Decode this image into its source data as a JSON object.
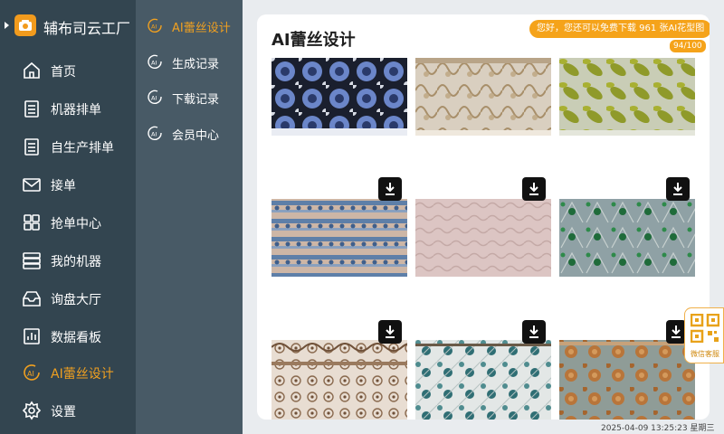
{
  "brand": {
    "name": "辅布司云工厂",
    "accent": "#f29b1d"
  },
  "sidebar": {
    "items": [
      {
        "label": "首页",
        "icon": "home-icon"
      },
      {
        "label": "机器排单",
        "icon": "list-icon"
      },
      {
        "label": "自生产排单",
        "icon": "list-icon"
      },
      {
        "label": "接单",
        "icon": "mail-icon"
      },
      {
        "label": "抢单中心",
        "icon": "grid-icon"
      },
      {
        "label": "我的机器",
        "icon": "server-icon"
      },
      {
        "label": "询盘大厅",
        "icon": "inbox-icon"
      },
      {
        "label": "数据看板",
        "icon": "chart-icon"
      },
      {
        "label": "AI蕾丝设计",
        "icon": "ai-icon",
        "active": true
      },
      {
        "label": "设置",
        "icon": "gear-icon"
      }
    ]
  },
  "submenu": {
    "items": [
      {
        "label": "AI蕾丝设计",
        "icon": "ai-icon",
        "active": true
      },
      {
        "label": "生成记录",
        "icon": "ai-icon"
      },
      {
        "label": "下载记录",
        "icon": "ai-icon"
      },
      {
        "label": "会员中心",
        "icon": "ai-icon"
      }
    ]
  },
  "main": {
    "title": "AI蕾丝设计",
    "notice": "您好，您还可以免费下载 961 张AI花型图",
    "counter": "94/100",
    "images": [
      {
        "name": "blue-floral-lace",
        "has_download": false
      },
      {
        "name": "beige-swirl-lace",
        "has_download": false
      },
      {
        "name": "olive-leaf-lace",
        "has_download": false
      },
      {
        "name": "blue-stripe-lace",
        "has_download": true
      },
      {
        "name": "pink-wave-lace",
        "has_download": true
      },
      {
        "name": "green-floral-lace",
        "has_download": true
      },
      {
        "name": "brown-scallop-lace",
        "has_download": true
      },
      {
        "name": "teal-floral-lace",
        "has_download": true
      },
      {
        "name": "orange-floral-lace",
        "has_download": true
      }
    ]
  },
  "qr_widget": {
    "label": "微信客服",
    "icon": "qr-code-icon"
  },
  "status": {
    "timestamp": "2025-04-09 13:25:23 星期三"
  }
}
